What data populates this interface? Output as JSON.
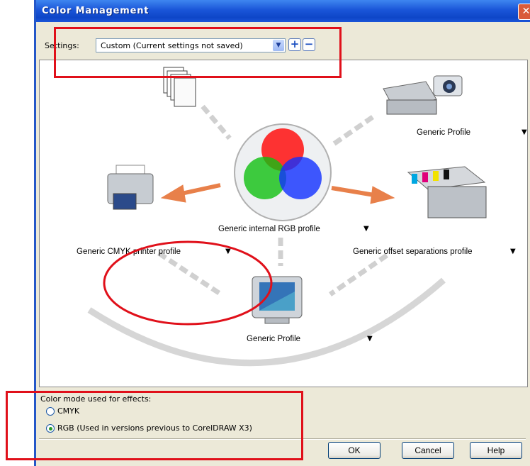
{
  "window": {
    "title": "Color Management",
    "close_glyph": "✕"
  },
  "settings": {
    "label": "Settings:",
    "selected": "Custom (Current settings not saved)",
    "add_glyph": "+",
    "remove_glyph": "−"
  },
  "profiles": {
    "scanner": "Generic Profile",
    "internal_rgb": "Generic internal RGB profile",
    "cmyk_printer": "Generic CMYK printer profile",
    "offset_separations": "Generic offset separations profile",
    "monitor": "Generic Profile"
  },
  "dropdown_glyph": "▼",
  "effects": {
    "heading": "Color mode used for effects:",
    "options": [
      {
        "label": "CMYK",
        "selected": false
      },
      {
        "label": "RGB (Used in versions previous to CorelDRAW X3)",
        "selected": true
      }
    ]
  },
  "buttons": {
    "ok": "OK",
    "cancel": "Cancel",
    "help": "Help"
  },
  "colors": {
    "title_bar": "#1a55d8",
    "annotation_red": "#e0101a",
    "orange_arrow": "#e8804a"
  }
}
